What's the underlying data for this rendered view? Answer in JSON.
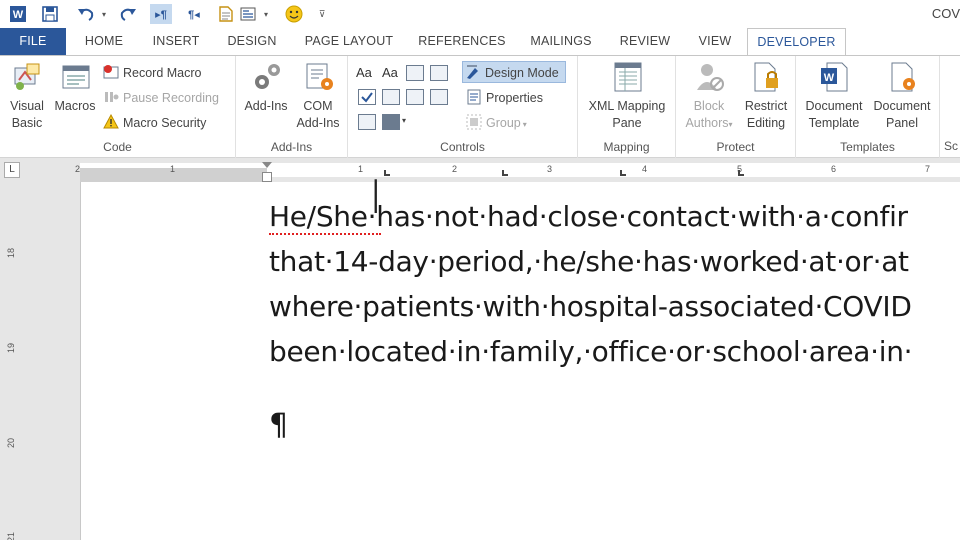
{
  "qat": {
    "doc_title": "COV"
  },
  "tabs": [
    "FILE",
    "HOME",
    "INSERT",
    "DESIGN",
    "PAGE LAYOUT",
    "REFERENCES",
    "MAILINGS",
    "REVIEW",
    "VIEW",
    "DEVELOPER"
  ],
  "ribbon": {
    "code": {
      "label": "Code",
      "visual_basic": [
        "Visual",
        "Basic"
      ],
      "macros": "Macros",
      "record_macro": "Record Macro",
      "pause_recording": "Pause Recording",
      "macro_security": "Macro Security"
    },
    "addins": {
      "label": "Add-Ins",
      "add_ins": [
        "Add-Ins"
      ],
      "com_add_ins": [
        "COM",
        "Add-Ins"
      ]
    },
    "controls": {
      "label": "Controls",
      "design_mode": "Design Mode",
      "properties": "Properties",
      "group": "Group"
    },
    "mapping": {
      "label": "Mapping",
      "xml_mapping": [
        "XML Mapping",
        "Pane"
      ]
    },
    "protect": {
      "label": "Protect",
      "block_authors": [
        "Block",
        "Authors"
      ],
      "restrict_editing": [
        "Restrict",
        "Editing"
      ]
    },
    "templates": {
      "label": "Templates",
      "document_template": [
        "Document",
        "Template"
      ],
      "document_panel": [
        "Document",
        "Panel"
      ]
    },
    "schema_partial": "Sc"
  },
  "ruler": {
    "numbers": [
      "2",
      "1",
      "1",
      "2",
      "3",
      "4",
      "5",
      "6",
      "7"
    ]
  },
  "vruler": {
    "numbers": [
      "18",
      "19",
      "20",
      "21"
    ]
  },
  "document": {
    "lines": [
      "He/She·has·not·had·close·contact·with·a·confir",
      "that·14-day·period,·he/she·has·worked·at·or·at",
      "where·patients·with·hospital-associated·COVID",
      "been·located·in·family,·office·or·school·area·in·"
    ],
    "pilcrow": "¶"
  },
  "colors": {
    "accent": "#2b579a",
    "ribbon_bg": "#ffffff",
    "workspace": "#e6e6e6"
  }
}
